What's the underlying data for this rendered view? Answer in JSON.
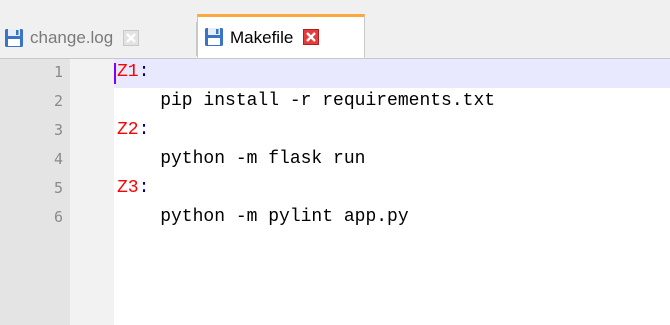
{
  "tabs": [
    {
      "label": "change.log",
      "active": false
    },
    {
      "label": "Makefile",
      "active": true
    }
  ],
  "colors": {
    "active_tab_accent": "#fba93c",
    "target_text": "#ff0000",
    "current_line": "#e8e8ff",
    "caret": "#8000ff"
  },
  "icons": {
    "tab_file": "floppy-disk-icon",
    "tab_close": "close-icon"
  },
  "lines": [
    {
      "number": "1",
      "target": "Z1",
      "colon": ":",
      "code": ""
    },
    {
      "number": "2",
      "target": "",
      "colon": "",
      "code": "    pip install -r requirements.txt"
    },
    {
      "number": "3",
      "target": "Z2",
      "colon": ":",
      "code": ""
    },
    {
      "number": "4",
      "target": "",
      "colon": "",
      "code": "    python -m flask run"
    },
    {
      "number": "5",
      "target": "Z3",
      "colon": ":",
      "code": ""
    },
    {
      "number": "6",
      "target": "",
      "colon": "",
      "code": "    python -m pylint app.py"
    }
  ]
}
